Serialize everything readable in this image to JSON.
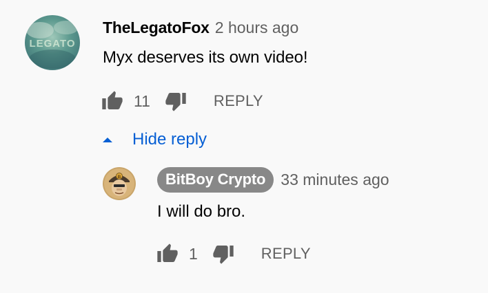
{
  "comment": {
    "author": "TheLegatoFox",
    "timestamp": "2 hours ago",
    "text": "Myx deserves its own video!",
    "likes": "11",
    "like_icon": "thumbs-up-icon",
    "dislike_icon": "thumbs-down-icon",
    "reply_label": "REPLY",
    "avatar_text": "LEGATO"
  },
  "replies_toggle": {
    "label": "Hide reply",
    "icon": "caret-up-icon"
  },
  "reply": {
    "author": "BitBoy Crypto",
    "timestamp": "33 minutes ago",
    "text": "I will do bro.",
    "likes": "1",
    "reply_label": "REPLY"
  },
  "colors": {
    "background": "#f9f9f9",
    "primary_text": "#030303",
    "secondary_text": "#606060",
    "link_blue": "#065fd4",
    "channel_badge": "#888888"
  }
}
